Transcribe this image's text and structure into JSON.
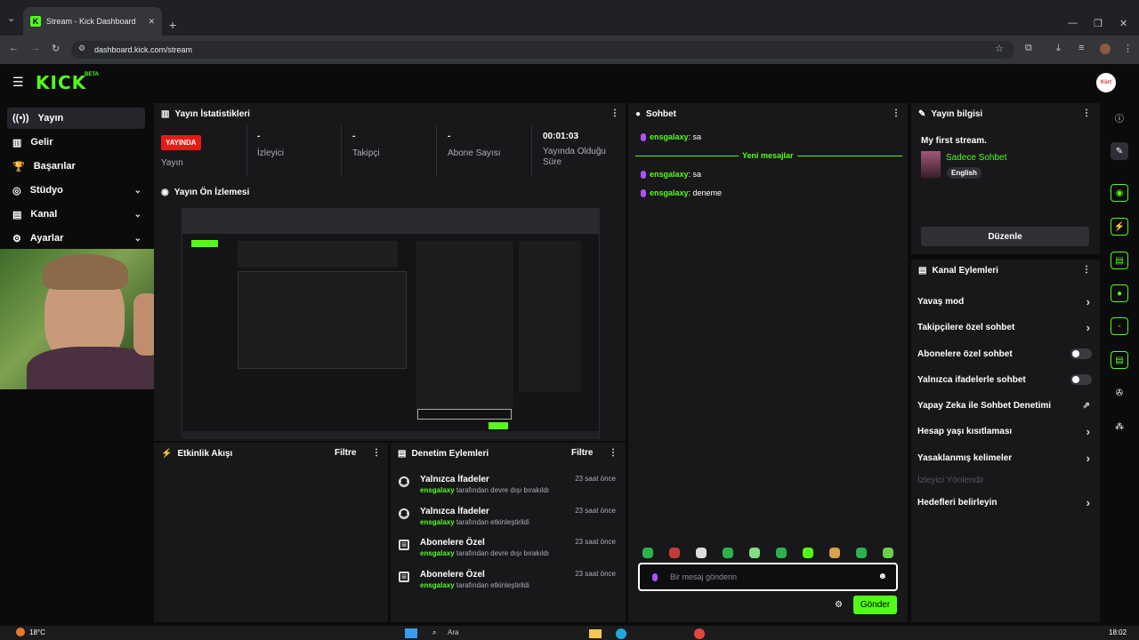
{
  "browser": {
    "tab_title": "Stream - Kick Dashboard",
    "url": "dashboard.kick.com/stream",
    "new_tab": "+",
    "tab_close": "✕"
  },
  "header": {
    "logo": "KICK",
    "badge": "BETA",
    "avatar_label": "Kürt"
  },
  "sidebar": {
    "items": [
      {
        "label": "Yayın",
        "icon": "broadcast-icon",
        "active": true
      },
      {
        "label": "Gelir",
        "icon": "chart-icon"
      },
      {
        "label": "Başarılar",
        "icon": "trophy-icon"
      },
      {
        "label": "Stüdyo",
        "icon": "studio-icon",
        "expandable": true
      },
      {
        "label": "Kanal",
        "icon": "channel-icon",
        "expandable": true
      },
      {
        "label": "Ayarlar",
        "icon": "gear-icon",
        "expandable": true
      }
    ]
  },
  "stats": {
    "title": "Yayın İstatistikleri",
    "live_badge": "YAYINDA",
    "live_label": "Yayın",
    "items": [
      {
        "value": "-",
        "label": "İzleyici"
      },
      {
        "value": "-",
        "label": "Takipçi"
      },
      {
        "value": "-",
        "label": "Abone Sayısı"
      },
      {
        "value": "00:01:03",
        "label": "Yayında Olduğu Süre"
      }
    ]
  },
  "preview": {
    "title": "Yayın Ön İzlemesi"
  },
  "activity": {
    "title": "Etkinlik Akışı",
    "filter": "Filtre"
  },
  "moderation": {
    "title": "Denetim Eylemleri",
    "filter": "Filtre",
    "items": [
      {
        "title": "Yalnızca İfadeler",
        "user": "ensgalaxy",
        "action": " tarafından devre dışı bırakıldı",
        "time": "23 saat önce",
        "icon": "emoji-icon"
      },
      {
        "title": "Yalnızca İfadeler",
        "user": "ensgalaxy",
        "action": " tarafından etkinleştirildi",
        "time": "23 saat önce",
        "icon": "emoji-icon"
      },
      {
        "title": "Abonelere Özel",
        "user": "ensgalaxy",
        "action": " tarafından devre dışı bırakıldı",
        "time": "23 saat önce",
        "icon": "gift-icon"
      },
      {
        "title": "Abonelere Özel",
        "user": "ensgalaxy",
        "action": " tarafından etkinleştirildi",
        "time": "23 saat önce",
        "icon": "gift-icon"
      }
    ]
  },
  "chat": {
    "title": "Sohbet",
    "messages_top": [
      {
        "user": "ensgalaxy",
        "text": ": sa"
      }
    ],
    "divider": "Yeni mesajlar",
    "messages": [
      {
        "user": "ensgalaxy",
        "text": ": sa"
      },
      {
        "user": "ensgalaxy",
        "text": ": deneme"
      }
    ],
    "input_placeholder": "Bir mesaj gönderin",
    "send": "Gönder"
  },
  "stream_info": {
    "title": "Yayın bilgisi",
    "stream_title": "My first stream.",
    "category": "Sadece Sohbet",
    "language": "English",
    "edit": "Düzenle"
  },
  "channel_actions": {
    "title": "Kanal Eylemleri",
    "items": [
      {
        "label": "Yavaş mod",
        "control": "arrow"
      },
      {
        "label": "Takipçilere özel sohbet",
        "control": "arrow"
      },
      {
        "label": "Abonelere özel sohbet",
        "control": "toggle"
      },
      {
        "label": "Yalnızca ifadelerle sohbet",
        "control": "toggle"
      },
      {
        "label": "Yapay Zeka ile Sohbet Denetimi",
        "control": "external"
      },
      {
        "label": "Hesap yaşı kısıtlaması",
        "control": "arrow"
      },
      {
        "label": "Yasaklanmış kelimeler",
        "control": "arrow"
      },
      {
        "label": "İzleyici Yönlendir",
        "control": "none",
        "disabled": true
      },
      {
        "label": "Hedefleri belirleyin",
        "control": "arrow"
      }
    ]
  },
  "taskbar": {
    "weather": "18°C",
    "search": "Ara",
    "clock": "18:02"
  },
  "colors": {
    "accent": "#53fc18",
    "live": "#e91916",
    "panel": "#18181b",
    "bg": "#0b0b0c"
  }
}
